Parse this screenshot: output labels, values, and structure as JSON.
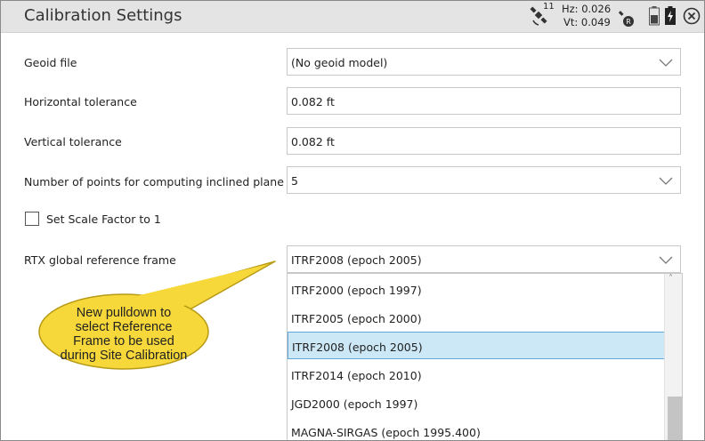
{
  "title": "Calibration Settings",
  "status": {
    "satellites": "11",
    "hz": "Hz: 0.026",
    "vt": "Vt: 0.049"
  },
  "colors": {
    "callout": "#f7d83a",
    "selected": "#cce8f6",
    "selected_border": "#5fa8d8"
  },
  "icons": [
    "satellite-icon",
    "rtx-icon",
    "battery-icon",
    "charging-icon",
    "close-icon",
    "chevron-down-icon"
  ],
  "form": {
    "geoid_label": "Geoid file",
    "geoid_value": "(No geoid model)",
    "htol_label": "Horizontal tolerance",
    "htol_value": "0.082 ft",
    "vtol_label": "Vertical tolerance",
    "vtol_value": "0.082 ft",
    "points_label": "Number of points for computing inclined plane",
    "points_value": "5",
    "scale_label": "Set Scale Factor to 1",
    "rtx_label": "RTX global reference frame",
    "rtx_value": "ITRF2008 (epoch 2005)"
  },
  "options": [
    "ITRF2000 (epoch 1997)",
    "ITRF2005 (epoch 2000)",
    "ITRF2008 (epoch 2005)",
    "ITRF2014 (epoch 2010)",
    "JGD2000 (epoch 1997)",
    "MAGNA-SIRGAS (epoch 1995.400)"
  ],
  "callout": {
    "line1": "New pulldown to",
    "line2": "select Reference",
    "line3": "Frame to be used",
    "line4": "during Site Calibration"
  }
}
